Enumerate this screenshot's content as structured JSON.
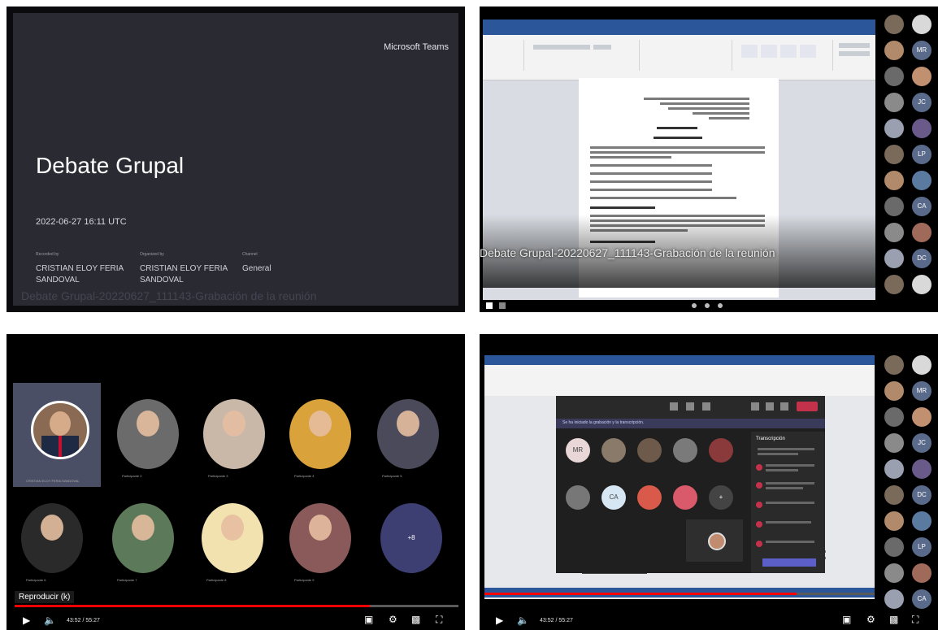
{
  "panel1": {
    "brand": "Microsoft Teams",
    "title": "Debate Grupal",
    "datetime": "2022-06-27 16:11 UTC",
    "columns": [
      {
        "key": "Recorded by",
        "value": "CRISTIAN ELOY FERIA SANDOVAL"
      },
      {
        "key": "Organized by",
        "value": "CRISTIAN ELOY FERIA SANDOVAL"
      },
      {
        "key": "Channel",
        "value": "General"
      }
    ],
    "ghost_caption": "Debate Grupal-20220627_111143-Grabación de la reunión"
  },
  "panel2": {
    "caption": "Debate Grupal-20220627_111143-Grabación de la reunión",
    "gallery_initials": [
      "MR",
      "JC",
      "LP",
      "CA",
      "DC"
    ]
  },
  "panel3": {
    "tooltip": "Reproducir (k)",
    "time": "43:52 / 55:27",
    "progress": 0.8,
    "speaker_label": "CRISTIAN ELOY FERIA SANDOVAL",
    "participants": [
      {
        "label": "Participante 2"
      },
      {
        "label": "Participante 3"
      },
      {
        "label": "Participante 4"
      },
      {
        "label": "Participante 5"
      },
      {
        "label": "Participante 6"
      },
      {
        "label": "Participante 7"
      },
      {
        "label": "Participante 8"
      },
      {
        "label": "Participante 9"
      },
      {
        "label": ""
      }
    ],
    "tile_initials": "+8"
  },
  "panel4": {
    "time": "43:52 / 55:27",
    "progress": 0.8,
    "teams_banner": "Se ha iniciado la grabación y la transcripción.",
    "chat_header": "Transcripción",
    "grid_initials": [
      "MR",
      "",
      "",
      "",
      "",
      "",
      "CA",
      "",
      "",
      "+"
    ],
    "gallery_initials": [
      "MR",
      "JC",
      "DC",
      "LP",
      "CA"
    ]
  },
  "colors": {
    "teams_bg": "#2a2a33",
    "word_blue": "#2b579a",
    "youtube_red": "#ff0000",
    "speaker_tile": "#4b4f66",
    "tile_purple": "#3d3e72"
  }
}
